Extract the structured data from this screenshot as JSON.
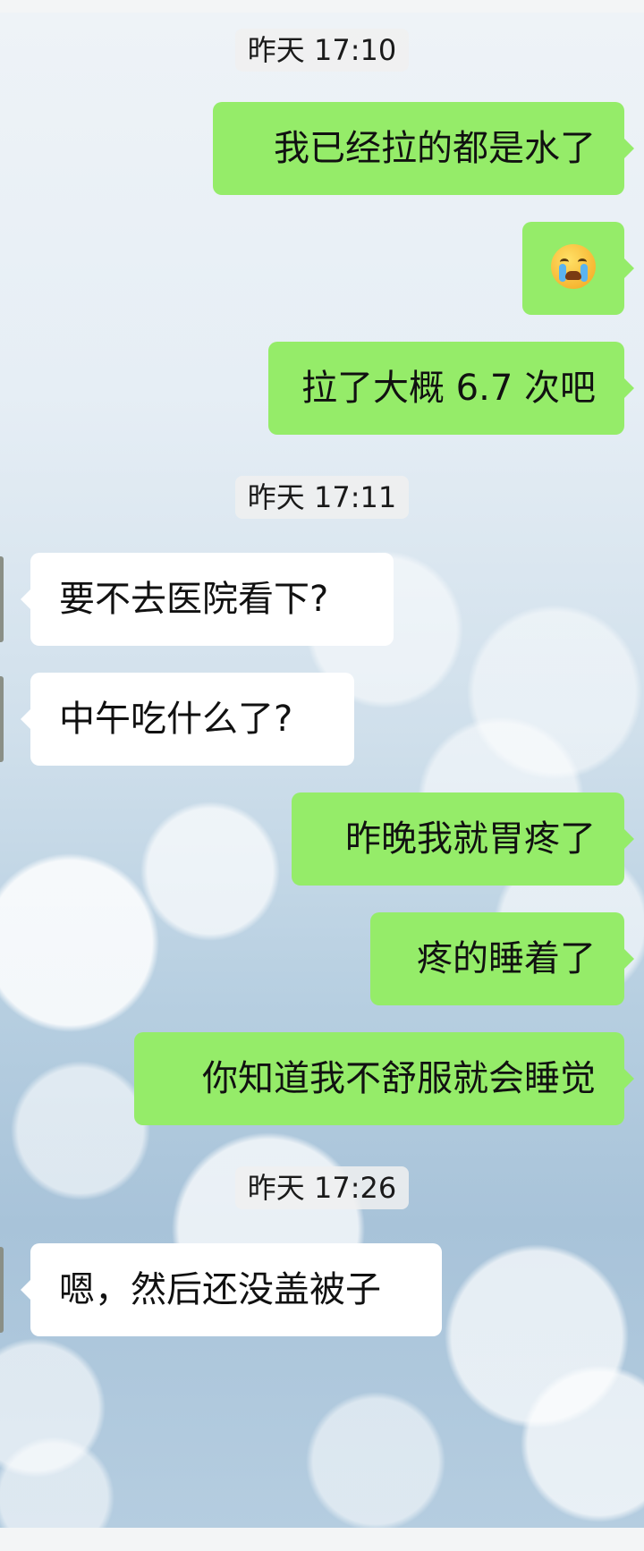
{
  "messages": [
    {
      "type": "timestamp",
      "text": "昨天 17:10"
    },
    {
      "type": "out",
      "text": "我已经拉的都是水了"
    },
    {
      "type": "out",
      "emoji": "loudly-crying-face"
    },
    {
      "type": "out",
      "text": "拉了大概 6.7 次吧"
    },
    {
      "type": "timestamp",
      "text": "昨天 17:11"
    },
    {
      "type": "in",
      "text": "要不去医院看下?"
    },
    {
      "type": "in",
      "text": "中午吃什么了?"
    },
    {
      "type": "out",
      "text": "昨晚我就胃疼了"
    },
    {
      "type": "out",
      "text": "疼的睡着了"
    },
    {
      "type": "out",
      "text": "你知道我不舒服就会睡觉"
    },
    {
      "type": "timestamp",
      "text": "昨天 17:26"
    },
    {
      "type": "in",
      "text": "嗯，然后还没盖被子"
    }
  ],
  "colors": {
    "outgoing_bubble": "#95ec69",
    "incoming_bubble": "#ffffff",
    "timestamp_bg": "#f0f0f0"
  }
}
